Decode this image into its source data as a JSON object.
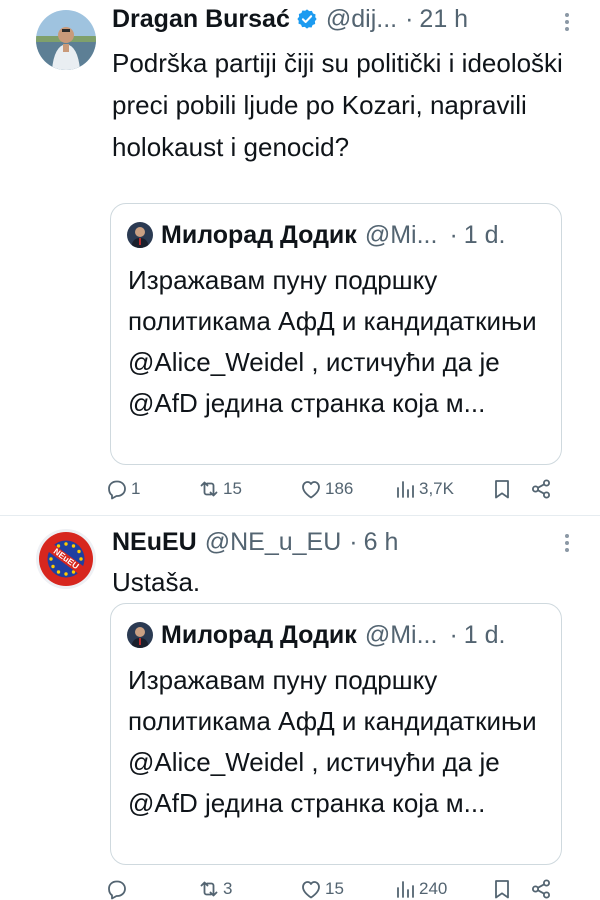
{
  "tweets": [
    {
      "author": {
        "name": "Dragan Bursać",
        "handle": "@dij...",
        "verified_icon": "verified-badge-icon",
        "time": "21 h",
        "dot": "·"
      },
      "text": "Podrška partiji čiji su politički i ideološki preci pobili ljude po Kozari, napravili holokaust i genocid?",
      "quote": {
        "name": "Милорад Додик",
        "handle": "@Mi...",
        "dot": "·",
        "time": "1 d.",
        "text": "Изражавам пуну подршку политикама АфД и кандидаткињи @Alice_Weidel , истичући да је @AfD једина странка која м..."
      },
      "actions": {
        "replies": "1",
        "retweets": "15",
        "likes": "186",
        "views": "3,7K"
      }
    },
    {
      "author": {
        "name": "NEuEU",
        "handle": "@NE_u_EU",
        "time": "6 h",
        "dot": "·"
      },
      "avatar_text": "NEuEU",
      "text": "Ustaša.",
      "quote": {
        "name": "Милорад Додик",
        "handle": "@Mi...",
        "dot": "·",
        "time": "1 d.",
        "text": "Изражавам пуну подршку политикама АфД и кандидаткињи @Alice_Weidel , истичући да је @AfD једина странка која м..."
      },
      "actions": {
        "replies": "",
        "retweets": "3",
        "likes": "15",
        "views": "240"
      }
    }
  ],
  "colors": {
    "text": "#0f1419",
    "secondary": "#536471",
    "verified": "#1d9bf0",
    "border": "#cfd9de",
    "neu_red": "#d7261e",
    "eu_blue": "#1f3fa0",
    "eu_star": "#ffcc00"
  }
}
